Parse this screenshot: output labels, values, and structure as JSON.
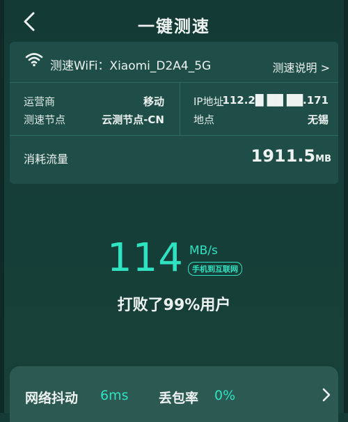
{
  "header": {
    "title": "一键测速",
    "back_icon": "chevron-left-icon"
  },
  "wifi": {
    "label": "测速WiFi：Xiaomi_D2A4_5G",
    "help_link": "测速说明 >",
    "icon": "wifi-icon"
  },
  "details": {
    "carrier_label": "运营商",
    "carrier_value": "移动",
    "node_label": "测速节点",
    "node_value": "云测节点-CN",
    "ip_label": "IP地址",
    "ip_value": "112.2█ ██ ██.171",
    "location_label": "地点",
    "location_value": "无锡"
  },
  "traffic": {
    "label": "消耗流量",
    "value": "1911.5",
    "unit": "MB"
  },
  "result": {
    "speed": "114",
    "unit": "MB/s",
    "badge": "手机到互联网",
    "beat_text": "打败了99%用户"
  },
  "network": {
    "jitter_label": "网络抖动",
    "jitter_value": "6ms",
    "loss_label": "丢包率",
    "loss_value": "0%"
  },
  "colors": {
    "accent": "#2fe3c2",
    "background": "#163b36",
    "card": "#1f4e48"
  }
}
